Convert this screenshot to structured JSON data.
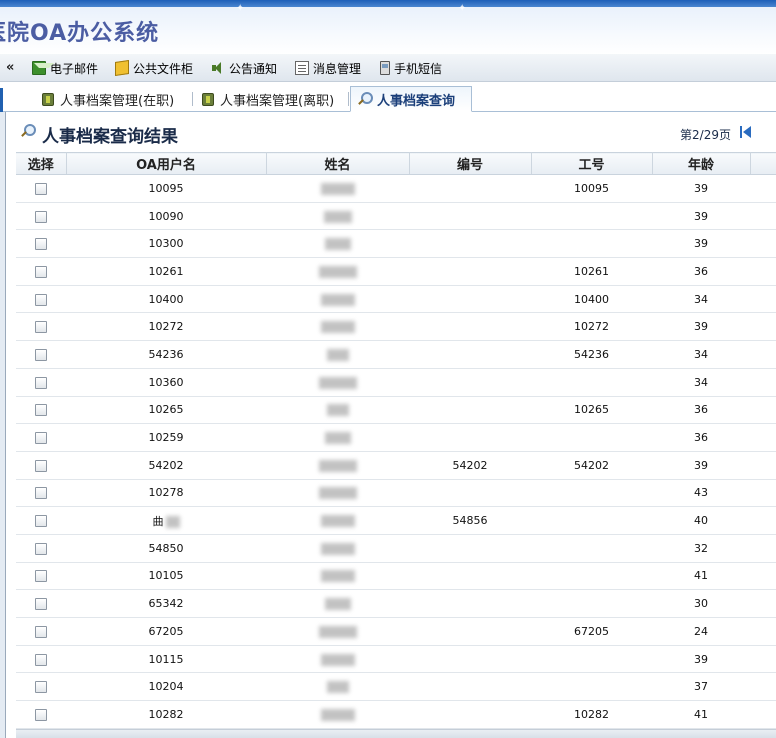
{
  "app": {
    "title": "医院OA办公系统",
    "title_visible": "医院OA办公系统"
  },
  "toolbar": {
    "collapse_glyph": "«",
    "items": [
      {
        "label": "电子邮件",
        "icon": "mail-icon"
      },
      {
        "label": "公共文件柜",
        "icon": "folder-icon"
      },
      {
        "label": "公告通知",
        "icon": "speaker-icon"
      },
      {
        "label": "消息管理",
        "icon": "message-icon"
      },
      {
        "label": "手机短信",
        "icon": "phone-icon"
      }
    ]
  },
  "tabs": [
    {
      "label": "人事档案管理(在职)",
      "icon": "package-icon",
      "active": false
    },
    {
      "label": "人事档案管理(离职)",
      "icon": "package-icon",
      "active": false
    },
    {
      "label": "人事档案查询",
      "icon": "magnifier-icon",
      "active": true
    }
  ],
  "results": {
    "title": "人事档案查询结果",
    "page_info": "第2/29页"
  },
  "table": {
    "columns": [
      "选择",
      "OA用户名",
      "姓名",
      "编号",
      "工号",
      "年龄"
    ],
    "rows": [
      {
        "user": "10095",
        "number": "",
        "staff_id": "10095",
        "age": "39"
      },
      {
        "user": "10090",
        "number": "",
        "staff_id": "",
        "age": "39"
      },
      {
        "user": "10300",
        "number": "",
        "staff_id": "",
        "age": "39"
      },
      {
        "user": "10261",
        "number": "",
        "staff_id": "10261",
        "age": "36"
      },
      {
        "user": "10400",
        "number": "",
        "staff_id": "10400",
        "age": "34"
      },
      {
        "user": "10272",
        "number": "",
        "staff_id": "10272",
        "age": "39"
      },
      {
        "user": "54236",
        "number": "",
        "staff_id": "54236",
        "age": "34"
      },
      {
        "user": "10360",
        "number": "",
        "staff_id": "",
        "age": "34"
      },
      {
        "user": "10265",
        "number": "",
        "staff_id": "10265",
        "age": "36"
      },
      {
        "user": "10259",
        "number": "",
        "staff_id": "",
        "age": "36"
      },
      {
        "user": "54202",
        "number": "54202",
        "staff_id": "54202",
        "age": "39"
      },
      {
        "user": "10278",
        "number": "",
        "staff_id": "",
        "age": "43"
      },
      {
        "user": "曲",
        "number": "54856",
        "staff_id": "",
        "age": "40"
      },
      {
        "user": "54850",
        "number": "",
        "staff_id": "",
        "age": "32"
      },
      {
        "user": "10105",
        "number": "",
        "staff_id": "",
        "age": "41"
      },
      {
        "user": "65342",
        "number": "",
        "staff_id": "",
        "age": "30"
      },
      {
        "user": "67205",
        "number": "",
        "staff_id": "67205",
        "age": "24"
      },
      {
        "user": "10115",
        "number": "",
        "staff_id": "",
        "age": "39"
      },
      {
        "user": "10204",
        "number": "",
        "staff_id": "",
        "age": "37"
      },
      {
        "user": "10282",
        "number": "",
        "staff_id": "10282",
        "age": "41"
      }
    ]
  }
}
